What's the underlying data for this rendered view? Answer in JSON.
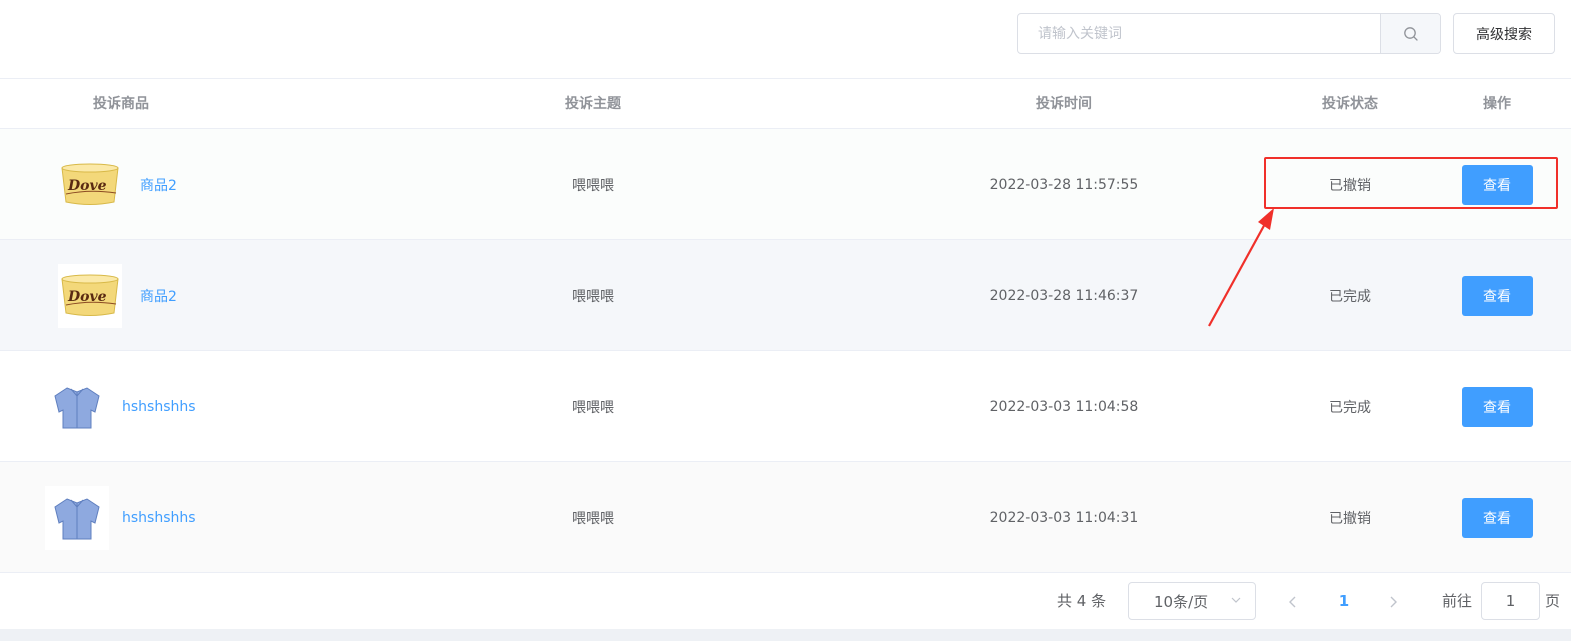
{
  "search": {
    "placeholder": "请输入关键词",
    "icon": "search-icon",
    "advanced_label": "高级搜索"
  },
  "table": {
    "headers": {
      "product": "投诉商品",
      "subject": "投诉主题",
      "time": "投诉时间",
      "status": "投诉状态",
      "action": "操作"
    },
    "rows": [
      {
        "product_name": "商品2",
        "product_image": "chocolate-tub-image",
        "subject": "喂喂喂",
        "time": "2022-03-28 11:57:55",
        "status": "已撤销",
        "action_label": "查看"
      },
      {
        "product_name": "商品2",
        "product_image": "chocolate-tub-image",
        "subject": "喂喂喂",
        "time": "2022-03-28 11:46:37",
        "status": "已完成",
        "action_label": "查看"
      },
      {
        "product_name": "hshshshhs",
        "product_image": "blue-shirt-image",
        "subject": "喂喂喂",
        "time": "2022-03-03 11:04:58",
        "status": "已完成",
        "action_label": "查看"
      },
      {
        "product_name": "hshshshhs",
        "product_image": "blue-shirt-image",
        "subject": "喂喂喂",
        "time": "2022-03-03 11:04:31",
        "status": "已撤销",
        "action_label": "查看"
      }
    ]
  },
  "pagination": {
    "total_text": "共 4 条",
    "page_size": "10条/页",
    "current_page": "1",
    "goto_prefix": "前往",
    "goto_value": "1",
    "goto_suffix": "页"
  },
  "colors": {
    "primary": "#409eff",
    "annotation": "#f0302a"
  }
}
